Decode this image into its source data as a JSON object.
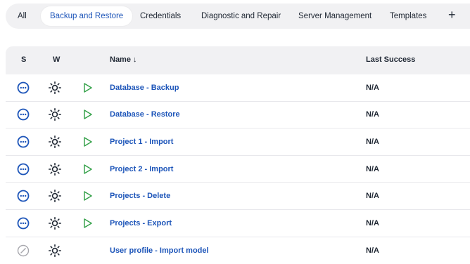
{
  "tabs": [
    {
      "label": "All",
      "active": false
    },
    {
      "label": "Backup and Restore",
      "active": true
    },
    {
      "label": "Credentials",
      "active": false
    },
    {
      "label": "Diagnostic and Repair",
      "active": false
    },
    {
      "label": "Server Management",
      "active": false
    },
    {
      "label": "Templates",
      "active": false
    }
  ],
  "add_tab_label": "+",
  "table": {
    "headers": {
      "status": "S",
      "weather": "W",
      "name": "Name ↓",
      "last_success": "Last Success"
    },
    "rows": [
      {
        "name": "Database - Backup",
        "last_success": "N/A",
        "status_icon": "in-progress-icon",
        "weather_icon": "sunny-weather-icon",
        "has_run_button": true
      },
      {
        "name": "Database - Restore",
        "last_success": "N/A",
        "status_icon": "in-progress-icon",
        "weather_icon": "sunny-weather-icon",
        "has_run_button": true
      },
      {
        "name": "Project 1 - Import",
        "last_success": "N/A",
        "status_icon": "in-progress-icon",
        "weather_icon": "sunny-weather-icon",
        "has_run_button": true
      },
      {
        "name": "Project 2 - Import",
        "last_success": "N/A",
        "status_icon": "in-progress-icon",
        "weather_icon": "sunny-weather-icon",
        "has_run_button": true
      },
      {
        "name": "Projects - Delete",
        "last_success": "N/A",
        "status_icon": "in-progress-icon",
        "weather_icon": "sunny-weather-icon",
        "has_run_button": true
      },
      {
        "name": "Projects - Export",
        "last_success": "N/A",
        "status_icon": "in-progress-icon",
        "weather_icon": "sunny-weather-icon",
        "has_run_button": true
      },
      {
        "name": "User profile - Import model",
        "last_success": "N/A",
        "status_icon": "disabled-icon",
        "weather_icon": "sunny-weather-icon",
        "has_run_button": false
      }
    ]
  },
  "colors": {
    "accent": "#1d55b9",
    "run_green": "#2f9e44",
    "disabled_gray": "#a7a7ad",
    "tab_bg": "#f1f1f3"
  }
}
